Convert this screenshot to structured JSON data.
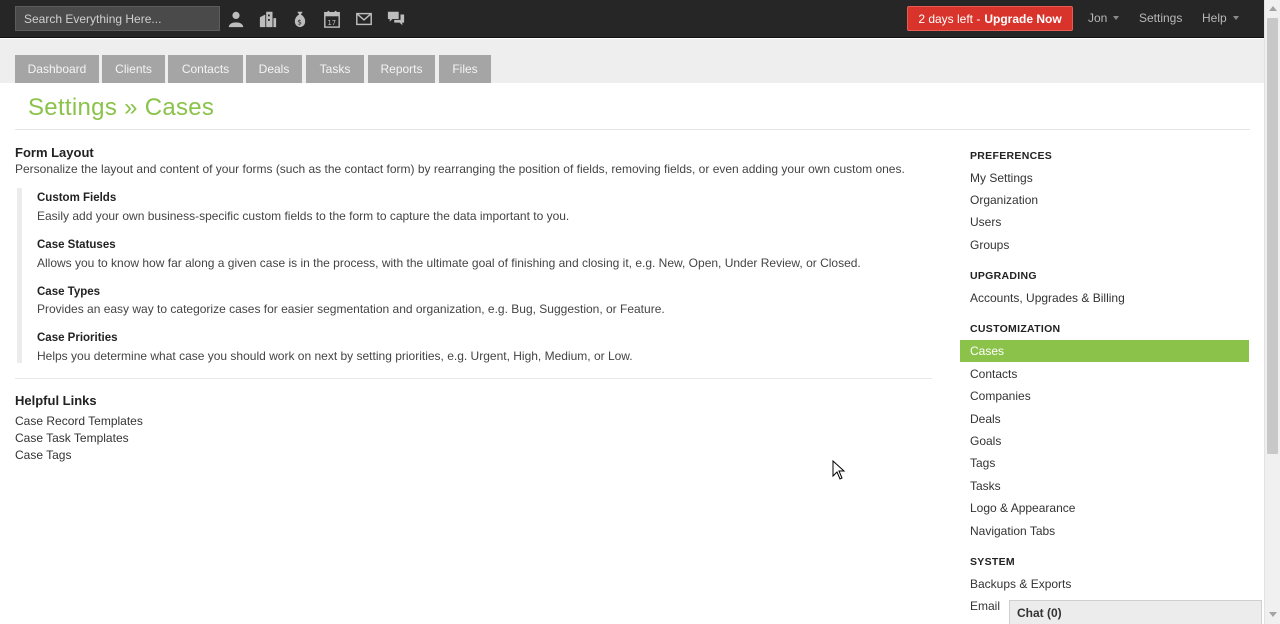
{
  "header": {
    "search_placeholder": "Search Everything Here...",
    "icons": [
      "person-icon",
      "buildings-icon",
      "money-bag-icon",
      "calendar-icon",
      "envelope-icon",
      "chat-bubbles-icon"
    ],
    "calendar_day": "17",
    "upgrade": {
      "prefix": "2 days left -",
      "action": "Upgrade Now",
      "color": "#d9342b"
    },
    "user": "Jon",
    "settings": "Settings",
    "help": "Help"
  },
  "tabs": [
    "Dashboard",
    "Clients",
    "Contacts",
    "Deals",
    "Tasks",
    "Reports",
    "Files"
  ],
  "page": {
    "title": "Settings » Cases",
    "accent": "#8bc34a"
  },
  "form_layout": {
    "heading": "Form Layout",
    "description": "Personalize the layout and content of your forms (such as the contact form) by rearranging the position of fields, removing fields, or even adding your own custom ones.",
    "features": [
      {
        "title": "Custom Fields",
        "desc": "Easily add your own business-specific custom fields to the form to capture the data important to you."
      },
      {
        "title": "Case Statuses",
        "desc": "Allows you to know how far along a given case is in the process, with the ultimate goal of finishing and closing it, e.g. New, Open, Under Review, or Closed."
      },
      {
        "title": "Case Types",
        "desc": "Provides an easy way to categorize cases for easier segmentation and organization, e.g. Bug, Suggestion, or Feature."
      },
      {
        "title": "Case Priorities",
        "desc": "Helps you determine what case you should work on next by setting priorities, e.g. Urgent, High, Medium, or Low."
      }
    ]
  },
  "helpful_links": {
    "heading": "Helpful Links",
    "links": [
      "Case Record Templates",
      "Case Task Templates",
      "Case Tags"
    ]
  },
  "sidebar": {
    "preferences": {
      "heading": "PREFERENCES",
      "items": [
        "My Settings",
        "Organization",
        "Users",
        "Groups"
      ]
    },
    "upgrading": {
      "heading": "UPGRADING",
      "items": [
        "Accounts, Upgrades & Billing"
      ]
    },
    "customization": {
      "heading": "CUSTOMIZATION",
      "active": "Cases",
      "items": [
        "Contacts",
        "Companies",
        "Deals",
        "Goals",
        "Tags",
        "Tasks",
        "Logo & Appearance",
        "Navigation Tabs"
      ]
    },
    "system": {
      "heading": "SYSTEM",
      "items": [
        "Backups & Exports",
        "Email"
      ]
    }
  },
  "chat": {
    "label": "Chat (0)"
  }
}
